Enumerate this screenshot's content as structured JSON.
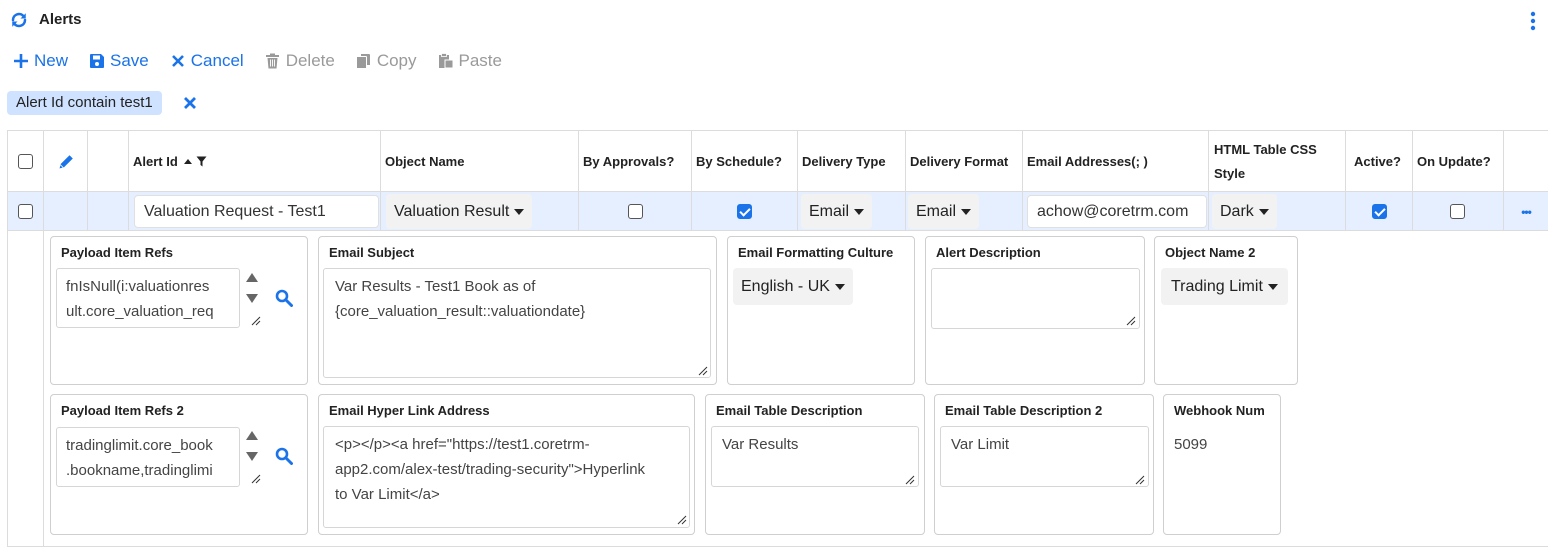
{
  "header": {
    "title": "Alerts",
    "accent": "#1a73e8",
    "refresh_icon": "refresh-icon",
    "menu_icon": "kebab-vertical-icon"
  },
  "toolbar": {
    "new_label": "New",
    "save_label": "Save",
    "cancel_label": "Cancel",
    "delete_label": "Delete",
    "copy_label": "Copy",
    "paste_label": "Paste"
  },
  "filter": {
    "chip_label": "Alert Id contain test1"
  },
  "grid": {
    "columns": {
      "alert_id": "Alert Id",
      "object_name": "Object Name",
      "by_approvals": "By Approvals?",
      "by_schedule": "By Schedule?",
      "delivery_type": "Delivery Type",
      "delivery_format": "Delivery Format",
      "email_addresses": "Email Addresses(; )",
      "html_css_line1": "HTML Table CSS",
      "html_css_line2": "Style",
      "active": "Active?",
      "on_update": "On Update?"
    },
    "row": {
      "selected": false,
      "alert_id": "Valuation Request - Test1",
      "object_name": "Valuation Result",
      "by_approvals": false,
      "by_schedule": true,
      "delivery_type": "Email",
      "delivery_format": "Email",
      "email_addresses": "achow@coretrm.com",
      "html_css_style": "Dark",
      "active": true,
      "on_update": false,
      "more_label": "•••"
    }
  },
  "detail": {
    "payload_item_refs": {
      "label": "Payload Item Refs",
      "line1": "fnIsNull(i:valuationres",
      "line2": "ult.core_valuation_req"
    },
    "email_subject": {
      "label": "Email Subject",
      "line1": "Var Results - Test1 Book as of",
      "line2": "{core_valuation_result::valuationdate}"
    },
    "email_formatting_culture": {
      "label": "Email Formatting Culture",
      "value": "English - UK"
    },
    "alert_description": {
      "label": "Alert Description",
      "value": ""
    },
    "object_name_2": {
      "label": "Object Name 2",
      "value": "Trading Limit"
    },
    "payload_item_refs_2": {
      "label": "Payload Item Refs 2",
      "line1": "tradinglimit.core_book",
      "line2": ".bookname,tradinglimi"
    },
    "email_hyper_link_address": {
      "label": "Email Hyper Link Address",
      "line1": "<p></p><a href=\"https://test1.coretrm-",
      "line2": "app2.com/alex-test/trading-security\">Hyperlink",
      "line3": "to Var Limit</a>"
    },
    "email_table_description": {
      "label": "Email Table Description",
      "value": "Var Results"
    },
    "email_table_description_2": {
      "label": "Email Table Description 2",
      "value": "Var Limit"
    },
    "webhook_num": {
      "label": "Webhook Num",
      "value": "5099"
    }
  }
}
